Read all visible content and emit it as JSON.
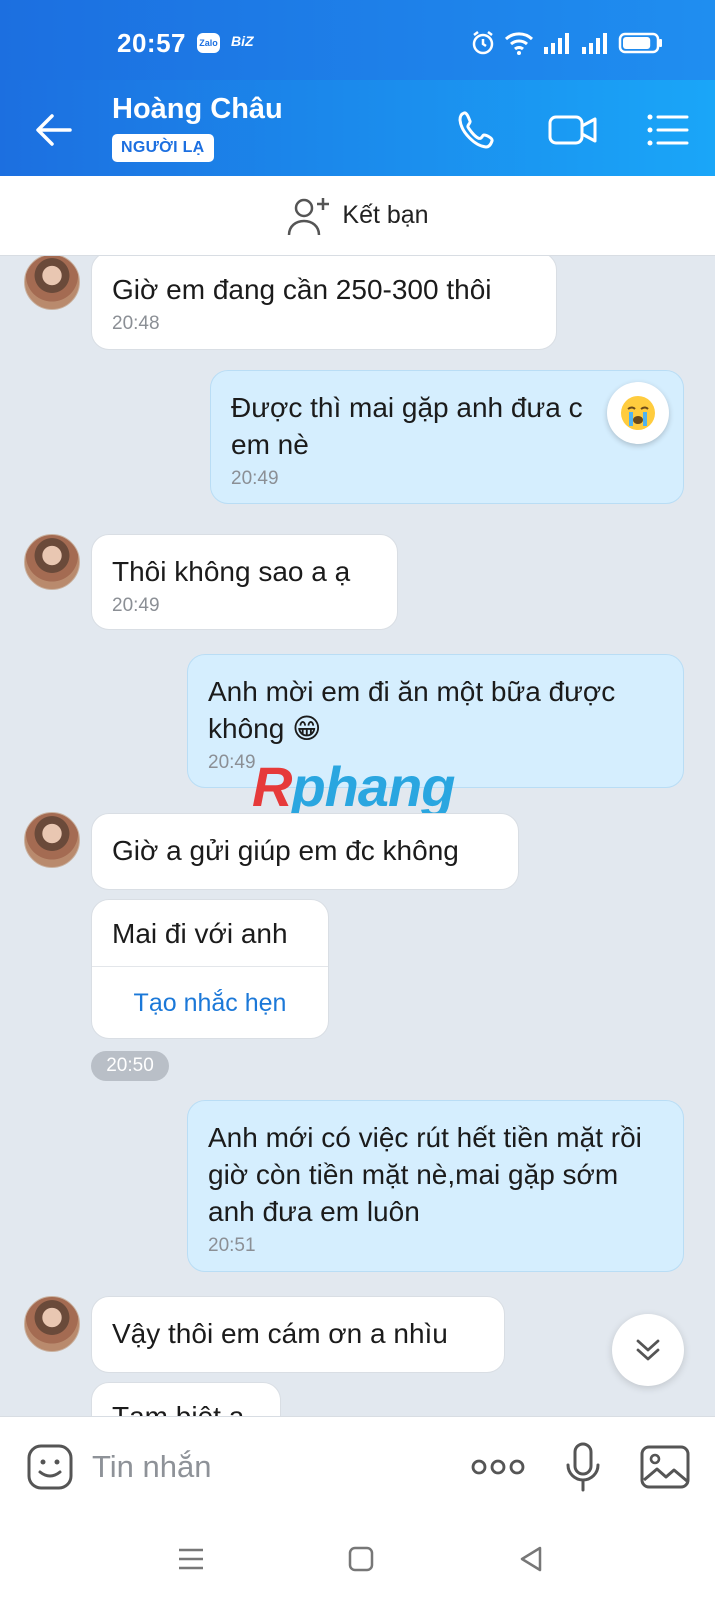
{
  "status_bar": {
    "time": "20:57",
    "app_badge": "Zalo",
    "app_label": "BiZ",
    "battery_level": 0.85
  },
  "header": {
    "contact_name": "Hoàng Châu",
    "badge": "NGƯỜI LẠ",
    "call_icon": "phone-icon",
    "video_icon": "video-icon",
    "menu_icon": "list-menu-icon"
  },
  "friend_bar": {
    "label": "Kết bạn",
    "icon": "add-friend-icon"
  },
  "messages": [
    {
      "direction": "in",
      "text": "Giờ em đang cần 250-300 thôi",
      "time": "20:48"
    },
    {
      "direction": "out",
      "text": "Được thì mai gặp anh đưa c em nè",
      "time": "20:49",
      "reaction": "crying-emoji"
    },
    {
      "direction": "in",
      "text": "Thôi không sao a ạ",
      "time": "20:49"
    },
    {
      "direction": "out",
      "text": "Anh mời em đi ăn một bữa được không 😁",
      "time": "20:49"
    },
    {
      "direction": "in",
      "text": "Giờ a gửi giúp em đc không",
      "time": ""
    },
    {
      "direction": "in",
      "text": "Mai đi với anh",
      "action": "Tạo nhắc hẹn",
      "time": "20:50"
    },
    {
      "direction": "out",
      "text": "Anh mới có việc rút hết tiền mặt rồi giờ còn tiền mặt nè,mai gặp sớm anh đưa em luôn",
      "time": "20:51"
    },
    {
      "direction": "in",
      "text": "Vậy thôi em cám ơn a nhìu",
      "time": ""
    },
    {
      "direction": "in",
      "text": "Tạm biệt a",
      "time": ""
    }
  ],
  "watermark": {
    "first": "R",
    "rest": "phang"
  },
  "input_bar": {
    "placeholder": "Tin nhắn",
    "more_label": "ooo"
  },
  "colors": {
    "header_start": "#1c6fe0",
    "header_end": "#1aa6f8",
    "incoming_bubble": "#ffffff",
    "outgoing_bubble": "#d5eefe",
    "chat_bg": "#e2e8ef",
    "link": "#1b78d8"
  }
}
